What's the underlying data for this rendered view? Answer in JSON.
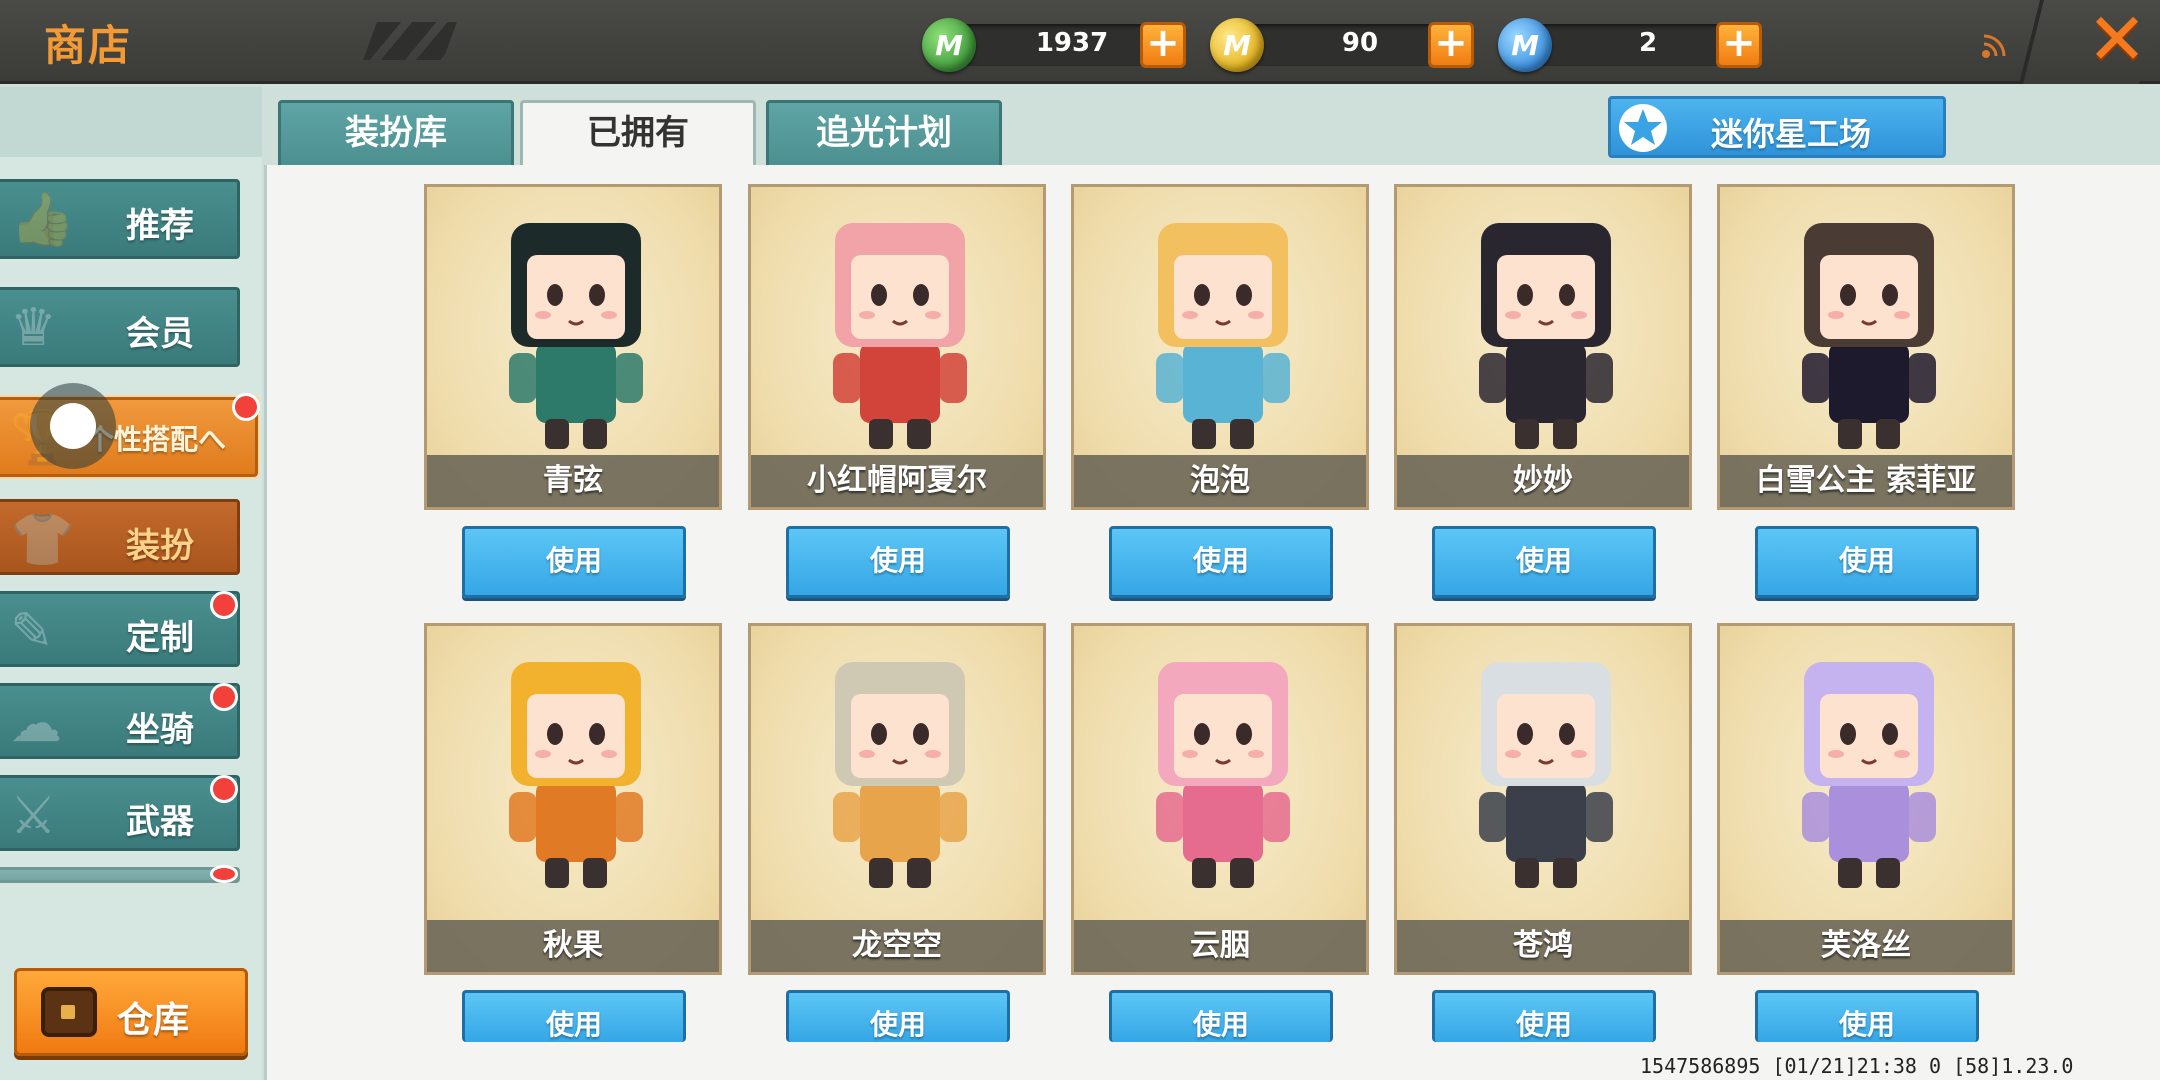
{
  "header": {
    "title": "商店",
    "currencies": [
      {
        "icon": "green-gem-icon",
        "label": "M",
        "value": "1937",
        "color": "#3f9a3a"
      },
      {
        "icon": "gold-coin-icon",
        "label": "M",
        "value": "90",
        "color": "#e3b21c"
      },
      {
        "icon": "blue-coin-icon",
        "label": "M",
        "value": "2",
        "color": "#3a8fe0"
      }
    ]
  },
  "sidebar": {
    "items": [
      {
        "label": "推荐",
        "icon": "thumbs-up-icon"
      },
      {
        "label": "会员",
        "icon": "crown-icon"
      },
      {
        "label": "个性搭配へ",
        "icon": "trophy-icon"
      },
      {
        "label": "装扮",
        "icon": "shirt-icon"
      },
      {
        "label": "定制",
        "icon": "brush-icon"
      },
      {
        "label": "坐骑",
        "icon": "saddle-icon"
      },
      {
        "label": "武器",
        "icon": "pistol-icon"
      }
    ],
    "warehouse_label": "仓库"
  },
  "tabs": [
    {
      "label": "装扮库"
    },
    {
      "label": "已拥有"
    },
    {
      "label": "追光计划"
    }
  ],
  "mini_star_workshop": "迷你星工场",
  "use_label": "使用",
  "cards": [
    {
      "name": "青弦",
      "color": "#2d7a6a",
      "hair": "#1c2a2a"
    },
    {
      "name": "小红帽阿夏尔",
      "color": "#d2443a",
      "hair": "#f2a3a8"
    },
    {
      "name": "泡泡",
      "color": "#58b3d4",
      "hair": "#f3c060"
    },
    {
      "name": "妙妙",
      "color": "#2a2630",
      "hair": "#2a2630"
    },
    {
      "name": "白雪公主 索菲亚",
      "color": "#1e1a2e",
      "hair": "#4a3c34"
    },
    {
      "name": "秋果",
      "color": "#e07a24",
      "hair": "#f3b22e"
    },
    {
      "name": "龙空空",
      "color": "#e8a44a",
      "hair": "#cfc9b4"
    },
    {
      "name": "云胭",
      "color": "#e56c8e",
      "hair": "#f3a8be"
    },
    {
      "name": "苍鸿",
      "color": "#3a3f4a",
      "hair": "#d9dee3"
    },
    {
      "name": "芙洛丝",
      "color": "#a98fdc",
      "hair": "#c4b3ee"
    }
  ],
  "status_line": "1547586895  [01/21]21:38 0  [58]1.23.0"
}
